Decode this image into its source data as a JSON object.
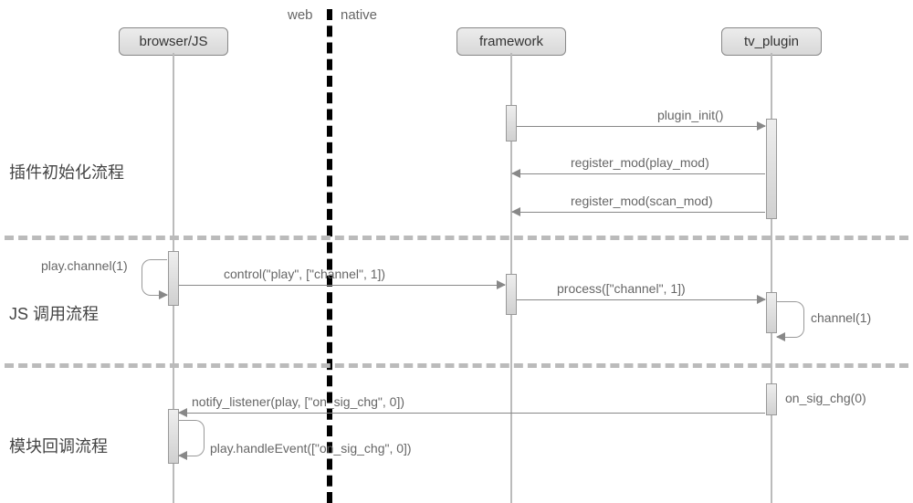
{
  "domain_labels": {
    "web": "web",
    "native": "native"
  },
  "lifelines": {
    "browser": "browser/JS",
    "framework": "framework",
    "tvplugin": "tv_plugin"
  },
  "phases": {
    "init": "插件初始化流程",
    "jscall": "JS 调用流程",
    "callback": "模块回调流程"
  },
  "messages": {
    "plugin_init": "plugin_init()",
    "register_play": "register_mod(play_mod)",
    "register_scan": "register_mod(scan_mod)",
    "play_channel": "play.channel(1)",
    "control": "control(\"play\", [\"channel\", 1])",
    "process": "process([\"channel\", 1])",
    "channel": "channel(1)",
    "notify": "notify_listener(play, [\"on_sig_chg\", 0])",
    "handle": "play.handleEvent([\"on_sig_chg\", 0])",
    "on_sig_chg": "on_sig_chg(0)"
  },
  "chart_data": {
    "type": "sequence-diagram",
    "lifelines": [
      "browser/JS",
      "framework",
      "tv_plugin"
    ],
    "domains": {
      "browser/JS": "web",
      "framework": "native",
      "tv_plugin": "native"
    },
    "phases": [
      {
        "name": "插件初始化流程",
        "messages": [
          {
            "from": "framework",
            "to": "tv_plugin",
            "label": "plugin_init()"
          },
          {
            "from": "tv_plugin",
            "to": "framework",
            "label": "register_mod(play_mod)"
          },
          {
            "from": "tv_plugin",
            "to": "framework",
            "label": "register_mod(scan_mod)"
          }
        ]
      },
      {
        "name": "JS 调用流程",
        "messages": [
          {
            "from": "browser/JS",
            "to": "browser/JS",
            "label": "play.channel(1)"
          },
          {
            "from": "browser/JS",
            "to": "framework",
            "label": "control(\"play\", [\"channel\", 1])"
          },
          {
            "from": "framework",
            "to": "tv_plugin",
            "label": "process([\"channel\", 1])"
          },
          {
            "from": "tv_plugin",
            "to": "tv_plugin",
            "label": "channel(1)"
          }
        ]
      },
      {
        "name": "模块回调流程",
        "messages": [
          {
            "from": "tv_plugin",
            "to": "tv_plugin",
            "label": "on_sig_chg(0)"
          },
          {
            "from": "tv_plugin",
            "to": "browser/JS",
            "label": "notify_listener(play, [\"on_sig_chg\", 0])"
          },
          {
            "from": "browser/JS",
            "to": "browser/JS",
            "label": "play.handleEvent([\"on_sig_chg\", 0])"
          }
        ]
      }
    ]
  }
}
